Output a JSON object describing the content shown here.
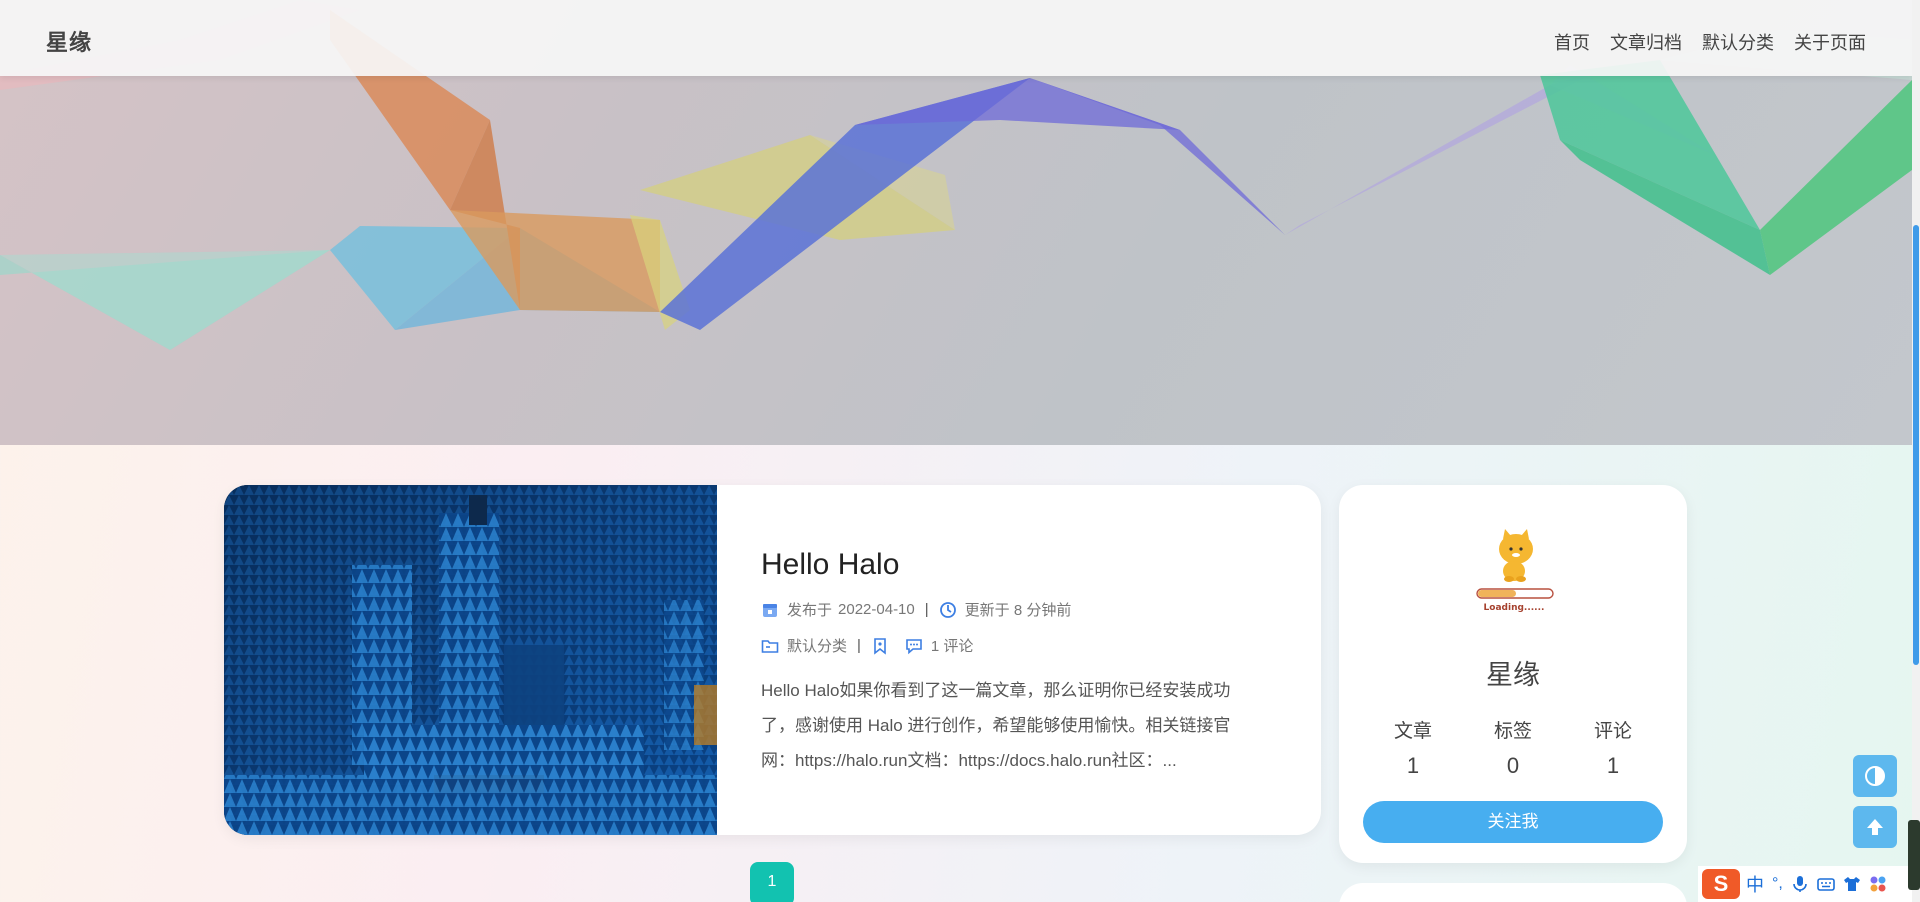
{
  "site": {
    "brand": "星缘",
    "nav": [
      {
        "label": "首页"
      },
      {
        "label": "文章归档"
      },
      {
        "label": "默认分类"
      },
      {
        "label": "关于页面"
      }
    ]
  },
  "post": {
    "title": "Hello Halo",
    "published_label": "发布于",
    "published_date": "2022-04-10",
    "updated_text": "更新于 8 分钟前",
    "category": "默认分类",
    "comments": "1 评论",
    "excerpt": "Hello Halo如果你看到了这一篇文章，那么证明你已经安装成功了，感谢使用 Halo 进行创作，希望能够使用愉快。相关链接官网：https://halo.run文档：https://docs.halo.run社区：..."
  },
  "pagination": {
    "current": "1"
  },
  "profile": {
    "loading_text": "Loading......",
    "name": "星缘",
    "stats": [
      {
        "label": "文章",
        "value": "1"
      },
      {
        "label": "标签",
        "value": "0"
      },
      {
        "label": "评论",
        "value": "1"
      }
    ],
    "follow_label": "关注我"
  },
  "ime": {
    "logo": "S",
    "lang": "中",
    "punct": "°,"
  },
  "colors": {
    "accent": "#47aef0",
    "pagination": "#12c2b0",
    "float_button": "#5db8ee",
    "scroll_thumb": "#3f9be9"
  }
}
